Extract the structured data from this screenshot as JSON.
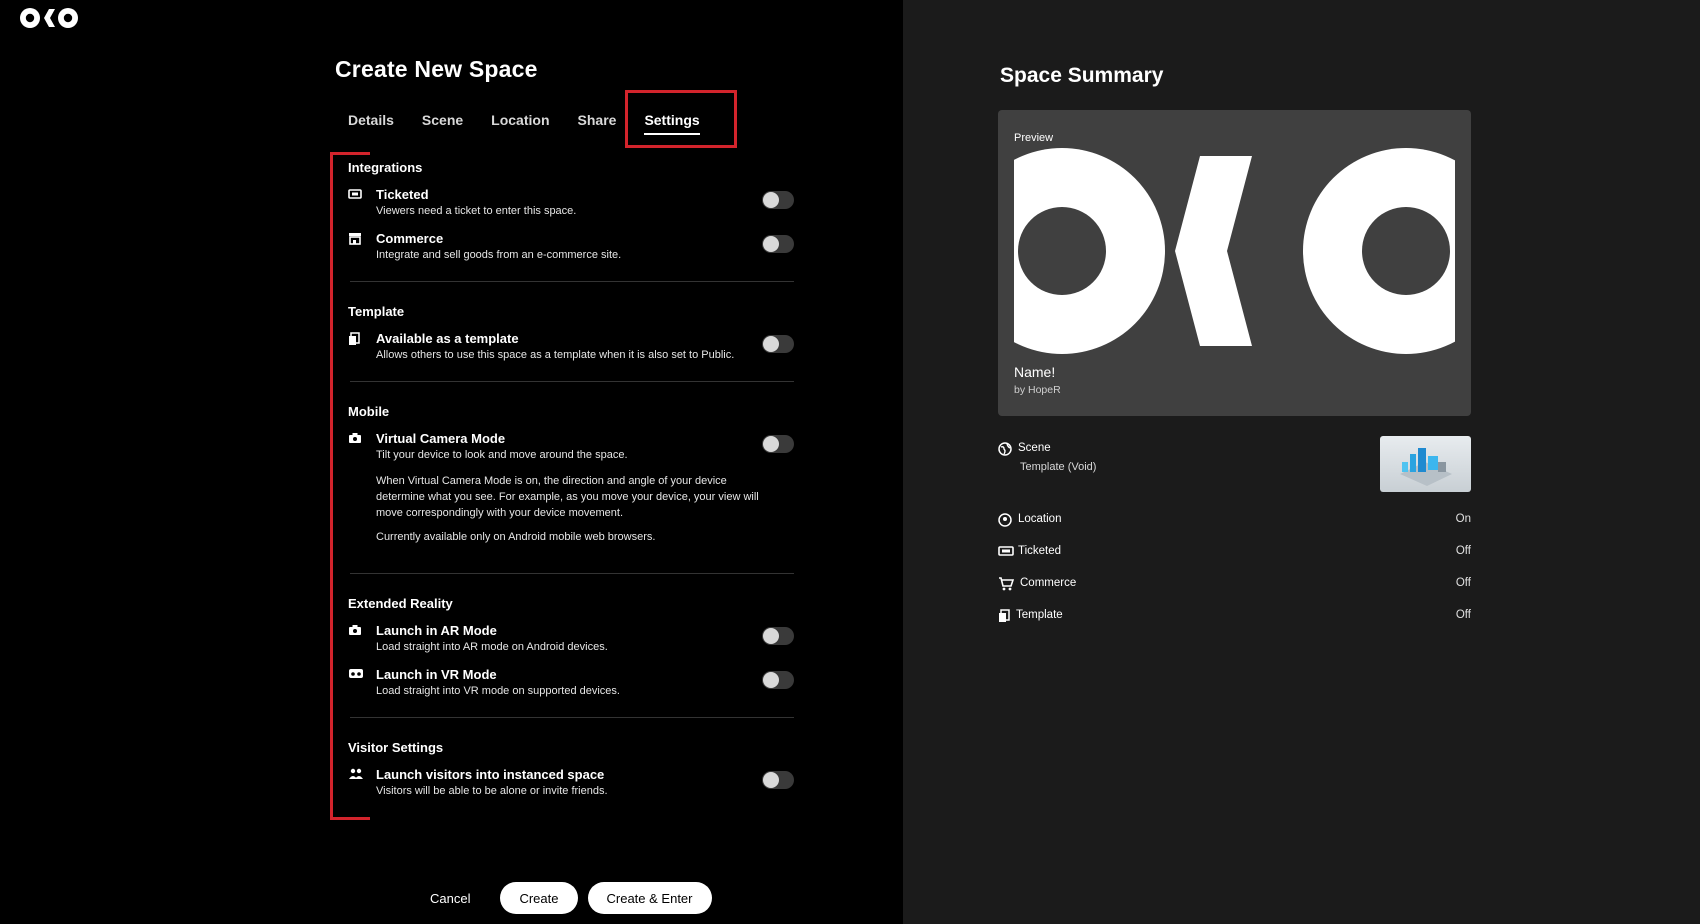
{
  "app": {
    "logo_text": "OKO"
  },
  "page": {
    "title": "Create New Space"
  },
  "tabs": [
    {
      "label": "Details"
    },
    {
      "label": "Scene"
    },
    {
      "label": "Location"
    },
    {
      "label": "Share"
    },
    {
      "label": "Settings",
      "active": true
    }
  ],
  "settings": {
    "integrations": {
      "title": "Integrations",
      "ticketed": {
        "label": "Ticketed",
        "desc": "Viewers need a ticket to enter this space.",
        "on": false
      },
      "commerce": {
        "label": "Commerce",
        "desc": "Integrate and sell goods from an e-commerce site.",
        "on": false
      }
    },
    "template": {
      "title": "Template",
      "available": {
        "label": "Available as a template",
        "desc": "Allows others to use this space as a template when it is also set to Public.",
        "on": false
      }
    },
    "mobile": {
      "title": "Mobile",
      "virtual_camera": {
        "label": "Virtual Camera Mode",
        "desc": "Tilt your device to look and move around the space.",
        "long": "When Virtual Camera Mode is on, the direction and angle of your device determine what you see. For example, as you move your device, your view will move correspondingly with your device movement.",
        "note": "Currently available only on Android mobile web browsers.",
        "on": false
      }
    },
    "xr": {
      "title": "Extended Reality",
      "ar": {
        "label": "Launch in AR Mode",
        "desc": "Load straight into AR mode on Android devices.",
        "on": false
      },
      "vr": {
        "label": "Launch in VR Mode",
        "desc": "Load straight into VR mode on supported devices.",
        "on": false
      }
    },
    "visitor": {
      "title": "Visitor Settings",
      "instanced": {
        "label": "Launch visitors into instanced space",
        "desc": "Visitors will be able to be alone or invite friends.",
        "on": false
      }
    }
  },
  "footer": {
    "cancel": "Cancel",
    "create": "Create",
    "create_enter": "Create & Enter"
  },
  "summary": {
    "title": "Space Summary",
    "preview_label": "Preview",
    "space_name": "Name!",
    "author": "by HopeR",
    "scene": {
      "label": "Scene",
      "value": "Template (Void)"
    },
    "location": {
      "label": "Location",
      "value": "On"
    },
    "ticketed": {
      "label": "Ticketed",
      "value": "Off"
    },
    "commerce": {
      "label": "Commerce",
      "value": "Off"
    },
    "template": {
      "label": "Template",
      "value": "Off"
    }
  },
  "colors": {
    "highlight_red": "#d3242c",
    "right_panel_bg": "#1b1b1b",
    "preview_bg": "#404040"
  }
}
